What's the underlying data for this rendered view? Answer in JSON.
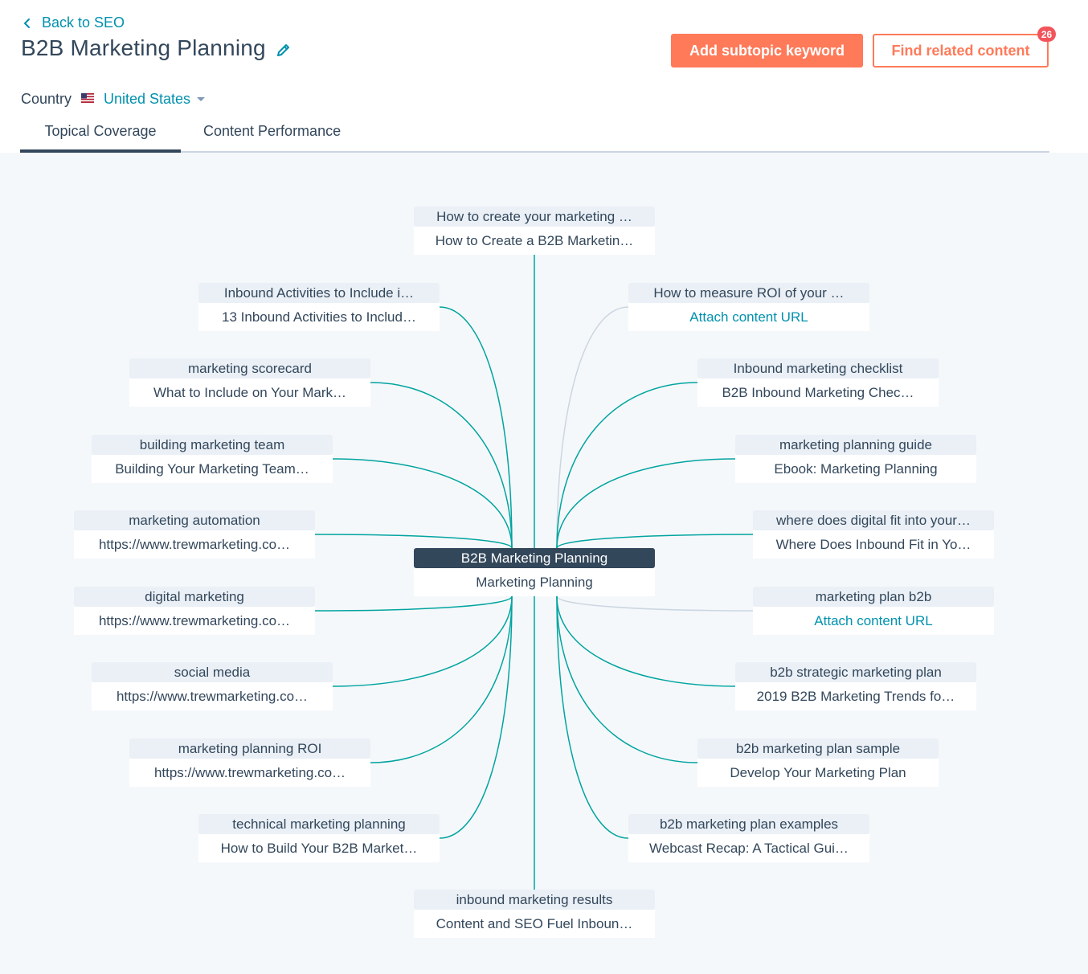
{
  "header": {
    "back_label": "Back to SEO",
    "title": "B2B Marketing Planning",
    "add_subtopic_label": "Add subtopic keyword",
    "find_related_label": "Find related content",
    "badge_count": "26"
  },
  "country": {
    "label": "Country",
    "value": "United States"
  },
  "tabs": [
    {
      "label": "Topical Coverage",
      "active": true
    },
    {
      "label": "Content Performance",
      "active": false
    }
  ],
  "colors": {
    "accent": "#ff7a59",
    "link": "#0091ae",
    "connector_covered": "#00a4a0",
    "connector_uncovered": "#cbd6e2",
    "center_fill": "#33475b"
  },
  "pillar": {
    "keyword": "B2B Marketing Planning",
    "content": "Marketing Planning"
  },
  "subtopics": [
    {
      "keyword": "How to create your marketing …",
      "content": "How to Create a B2B Marketin…",
      "linked": true
    },
    {
      "keyword": "Inbound Activities to Include i…",
      "content": "13 Inbound Activities to Includ…",
      "linked": true
    },
    {
      "keyword": "How to measure ROI of your …",
      "content": "Attach content URL",
      "linked": false
    },
    {
      "keyword": "marketing scorecard",
      "content": "What to Include on Your Mark…",
      "linked": true
    },
    {
      "keyword": "Inbound marketing checklist",
      "content": "B2B Inbound Marketing Chec…",
      "linked": true
    },
    {
      "keyword": "building marketing team",
      "content": "Building Your Marketing Team…",
      "linked": true
    },
    {
      "keyword": "marketing planning guide",
      "content": "Ebook: Marketing Planning",
      "linked": true
    },
    {
      "keyword": "marketing automation",
      "content": "https://www.trewmarketing.co…",
      "linked": true
    },
    {
      "keyword": "where does digital fit into your…",
      "content": "Where Does Inbound Fit in Yo…",
      "linked": true
    },
    {
      "keyword": "digital marketing",
      "content": "https://www.trewmarketing.co…",
      "linked": true
    },
    {
      "keyword": "marketing plan b2b",
      "content": "Attach content URL",
      "linked": false
    },
    {
      "keyword": "social media",
      "content": "https://www.trewmarketing.co…",
      "linked": true
    },
    {
      "keyword": "b2b strategic marketing plan",
      "content": "2019 B2B Marketing Trends fo…",
      "linked": true
    },
    {
      "keyword": "marketing planning ROI",
      "content": "https://www.trewmarketing.co…",
      "linked": true
    },
    {
      "keyword": "b2b marketing plan sample",
      "content": "Develop Your Marketing Plan",
      "linked": true
    },
    {
      "keyword": "technical marketing planning",
      "content": "How to Build Your B2B Market…",
      "linked": true
    },
    {
      "keyword": "b2b marketing plan examples",
      "content": "Webcast Recap: A Tactical Gui…",
      "linked": true
    },
    {
      "keyword": "inbound marketing results",
      "content": "Content and SEO Fuel Inboun…",
      "linked": true
    }
  ]
}
